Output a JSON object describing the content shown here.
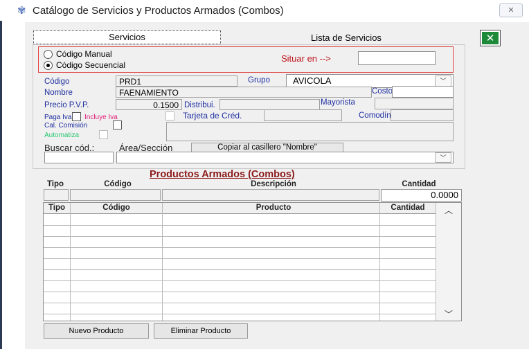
{
  "window": {
    "title": "Catálogo de Servicios y Productos Armados (Combos)",
    "close_symbol": "✕"
  },
  "tabs": [
    {
      "label": "Servicios"
    },
    {
      "label": "Lista de Servicios"
    }
  ],
  "excel_icon": "excel-icon",
  "code_mode": {
    "manual_label": "Código Manual",
    "sequential_label": "Código Secuencial",
    "selected": "Código Secuencial",
    "situar_label": "Situar en -->",
    "situar_value": ""
  },
  "form": {
    "codigo_label": "Código",
    "codigo_value": "PRD1",
    "grupo_label": "Grupo",
    "grupo_value": "AVICOLA",
    "nombre_label": "Nombre",
    "nombre_value": "FAENAMIENTO",
    "costo_label": "Costo",
    "costo_value": "",
    "pvp_label": "Precio P.V.P.",
    "pvp_value": "0.1500",
    "distribui_label": "Distribui.",
    "distribui_value": "",
    "mayorista_label": "Mayorista",
    "mayorista_value": "",
    "paga_iva_label": "Paga Iva",
    "incluye_iva_label": "Incluye Iva",
    "tarjeta_label": "Tarjeta de Créd.",
    "tarjeta_value": "",
    "comodin_label": "Comodín",
    "comodin_value": "",
    "cal_comision_label": "Cal. Comisión",
    "automatiza_label": "Automatiza",
    "buscar_label": "Buscar cód.:",
    "area_label": "Área/Sección",
    "copiar_label": "Copiar al casillero \"Nombre\"",
    "area_value": ""
  },
  "combos": {
    "title": "Productos Armados (Combos)",
    "entry_headers": [
      "Tipo",
      "Código",
      "Descripción",
      "Cantidad"
    ],
    "entry_cantidad": "0.0000",
    "grid_headers": [
      "Tipo",
      "Código",
      "Producto",
      "Cantidad"
    ],
    "rows": []
  },
  "buttons": {
    "nuevo": "Nuevo Producto",
    "eliminar": "Eliminar Producto"
  }
}
